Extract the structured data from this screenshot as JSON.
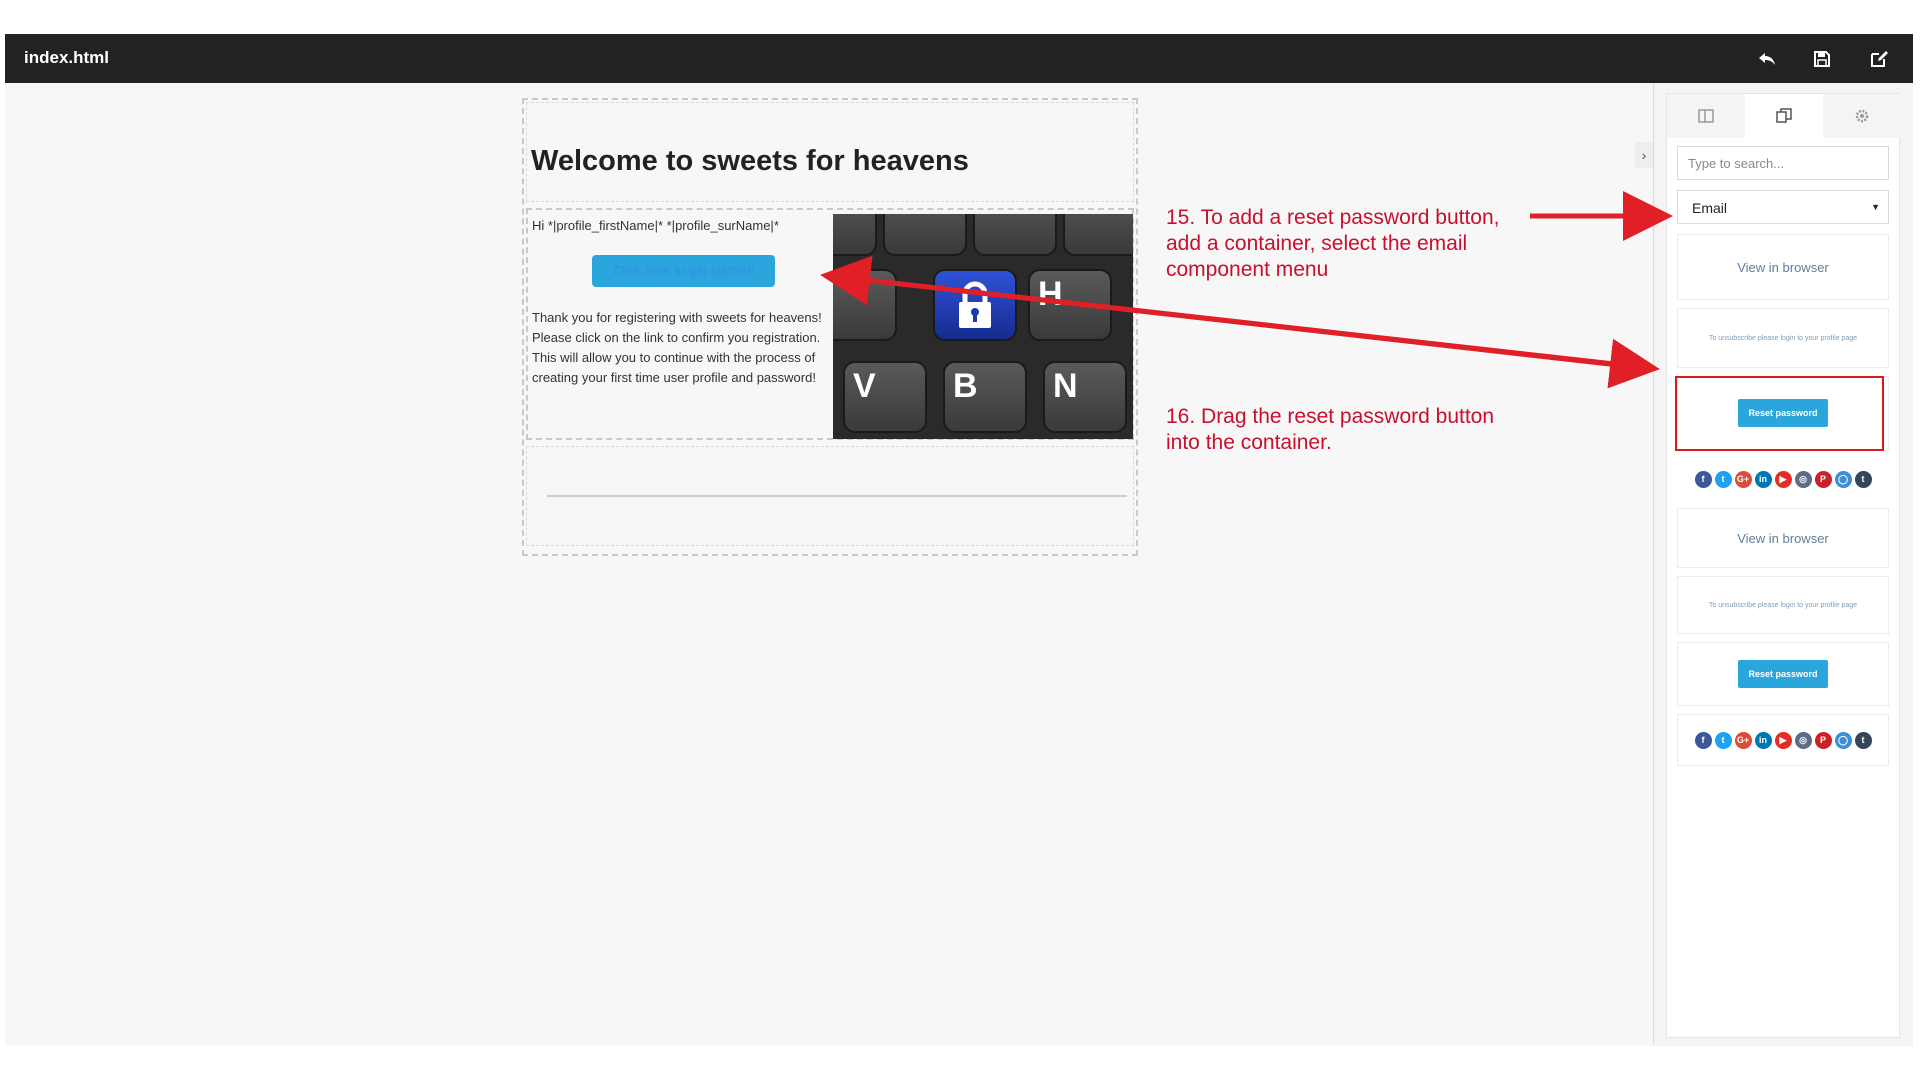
{
  "window": {
    "title": "index.html"
  },
  "toolbar": {
    "undo_icon": "undo-icon",
    "save_icon": "save-icon",
    "edit_icon": "edit-icon"
  },
  "email": {
    "title": "Welcome to sweets for heavens",
    "greeting": "Hi *|profile_firstName|* *|profile_surName|*",
    "cta_label": "Click here to get started!",
    "body_lines": [
      "Thank you for registering with sweets for heavens!",
      "Please click on the link to confirm you registration. This will allow you to continue with the process of creating your first time user profile and password!"
    ],
    "keyboard_keys": [
      "H",
      "V",
      "B",
      "N"
    ]
  },
  "annotations": {
    "step15": "15. To add a reset password button, add a container, select the email component menu",
    "step16": "16. Drag the reset password button into the container."
  },
  "panel": {
    "search_placeholder": "Type to search...",
    "category_selected": "Email",
    "blocks": {
      "view_in_browser": "View in browser",
      "unsubscribe": "To unsubscribe please login to your profile page",
      "reset_password": "Reset password"
    },
    "social_icons": [
      {
        "name": "facebook-icon",
        "glyph": "f",
        "color": "#3b5998"
      },
      {
        "name": "twitter-icon",
        "glyph": "t",
        "color": "#1da1f2"
      },
      {
        "name": "google-plus-icon",
        "glyph": "G+",
        "color": "#dd4b39"
      },
      {
        "name": "linkedin-icon",
        "glyph": "in",
        "color": "#0077b5"
      },
      {
        "name": "youtube-icon",
        "glyph": "▶",
        "color": "#e52d27"
      },
      {
        "name": "instagram-icon",
        "glyph": "◎",
        "color": "#5b6d86"
      },
      {
        "name": "pinterest-icon",
        "glyph": "P",
        "color": "#cb2027"
      },
      {
        "name": "github-icon",
        "glyph": "◯",
        "color": "#3d8ed9"
      },
      {
        "name": "tumblr-icon",
        "glyph": "t",
        "color": "#35465c"
      }
    ]
  },
  "colors": {
    "accent": "#2ba6dd",
    "annotation": "#c8102e",
    "highlight": "#d71920",
    "topbar": "#222222"
  }
}
